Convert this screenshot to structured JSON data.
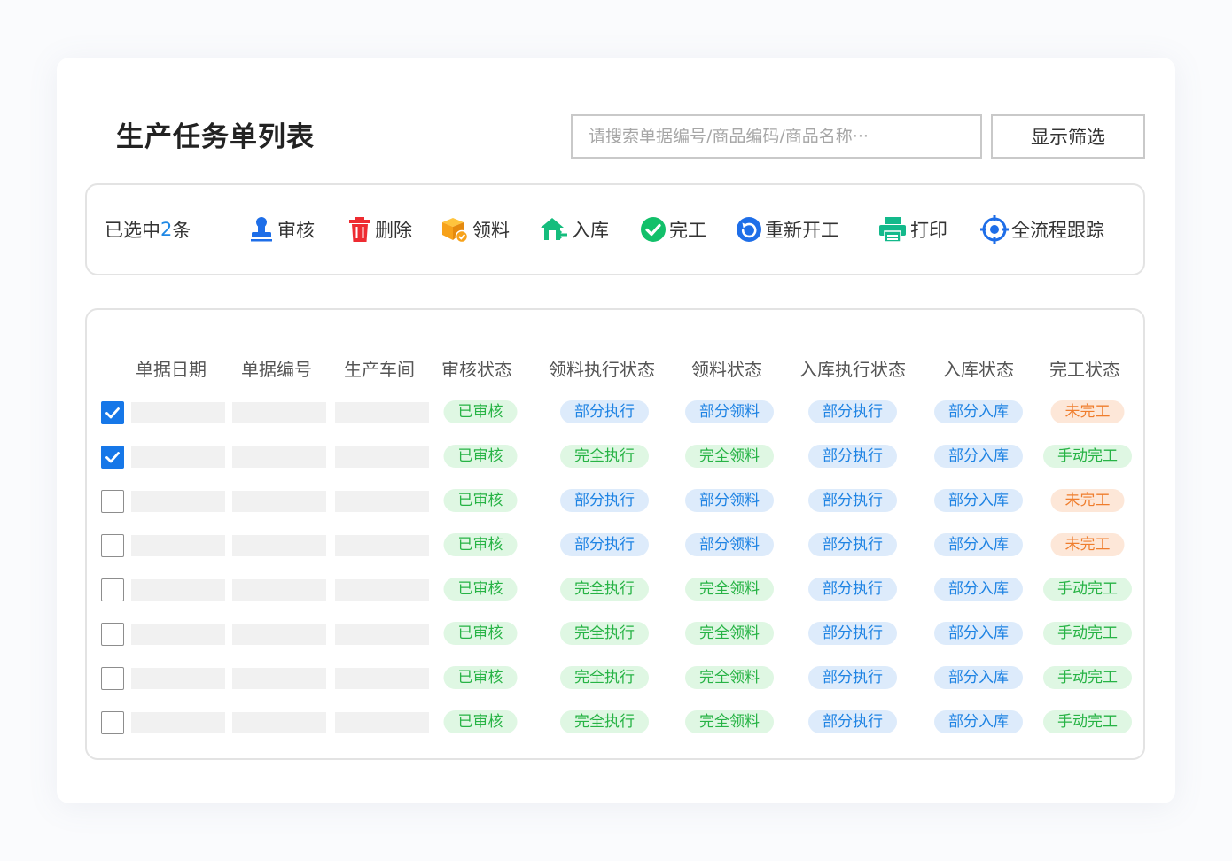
{
  "header": {
    "title": "生产任务单列表",
    "search_placeholder": "请搜索单据编号/商品编码/商品名称···",
    "filter_button": "显示筛选"
  },
  "toolbar": {
    "selected_prefix": "已选中",
    "selected_count": "2",
    "selected_suffix": "条",
    "actions": [
      {
        "label": "审核",
        "icon": "stamp-icon",
        "color": "#1e6ee8"
      },
      {
        "label": "删除",
        "icon": "trash-icon",
        "color": "#ee2b31"
      },
      {
        "label": "领料",
        "icon": "box-icon",
        "color": "#f7a21a"
      },
      {
        "label": "入库",
        "icon": "warehouse-in-icon",
        "color": "#15bd7d"
      },
      {
        "label": "完工",
        "icon": "check-circle-icon",
        "color": "#12c06a"
      },
      {
        "label": "重新开工",
        "icon": "restart-icon",
        "color": "#1e6ee8"
      },
      {
        "label": "打印",
        "icon": "printer-icon",
        "color": "#13b98b"
      },
      {
        "label": "全流程跟踪",
        "icon": "target-icon",
        "color": "#1e6ee8"
      }
    ]
  },
  "table": {
    "columns": [
      "单据日期",
      "单据编号",
      "生产车间",
      "审核状态",
      "领料执行状态",
      "领料状态",
      "入库执行状态",
      "入库状态",
      "完工状态"
    ],
    "rows": [
      {
        "checked": true,
        "statuses": [
          "已审核",
          "部分执行",
          "部分领料",
          "部分执行",
          "部分入库",
          "未完工"
        ],
        "tones": [
          "green",
          "blue",
          "blue",
          "blue",
          "blue",
          "orange"
        ]
      },
      {
        "checked": true,
        "statuses": [
          "已审核",
          "完全执行",
          "完全领料",
          "部分执行",
          "部分入库",
          "手动完工"
        ],
        "tones": [
          "green",
          "green",
          "green",
          "blue",
          "blue",
          "green"
        ]
      },
      {
        "checked": false,
        "statuses": [
          "已审核",
          "部分执行",
          "部分领料",
          "部分执行",
          "部分入库",
          "未完工"
        ],
        "tones": [
          "green",
          "blue",
          "blue",
          "blue",
          "blue",
          "orange"
        ]
      },
      {
        "checked": false,
        "statuses": [
          "已审核",
          "部分执行",
          "部分领料",
          "部分执行",
          "部分入库",
          "未完工"
        ],
        "tones": [
          "green",
          "blue",
          "blue",
          "blue",
          "blue",
          "orange"
        ]
      },
      {
        "checked": false,
        "statuses": [
          "已审核",
          "完全执行",
          "完全领料",
          "部分执行",
          "部分入库",
          "手动完工"
        ],
        "tones": [
          "green",
          "green",
          "green",
          "blue",
          "blue",
          "green"
        ]
      },
      {
        "checked": false,
        "statuses": [
          "已审核",
          "完全执行",
          "完全领料",
          "部分执行",
          "部分入库",
          "手动完工"
        ],
        "tones": [
          "green",
          "green",
          "green",
          "blue",
          "blue",
          "green"
        ]
      },
      {
        "checked": false,
        "statuses": [
          "已审核",
          "完全执行",
          "完全领料",
          "部分执行",
          "部分入库",
          "手动完工"
        ],
        "tones": [
          "green",
          "green",
          "green",
          "blue",
          "blue",
          "green"
        ]
      },
      {
        "checked": false,
        "statuses": [
          "已审核",
          "完全执行",
          "完全领料",
          "部分执行",
          "部分入库",
          "手动完工"
        ],
        "tones": [
          "green",
          "green",
          "green",
          "blue",
          "blue",
          "green"
        ]
      }
    ]
  },
  "colors": {
    "accent": "#1677e8",
    "green_text": "#27b345",
    "green_bg": "#dff7e3",
    "blue_text": "#1e83e3",
    "blue_bg": "#ddebfb",
    "orange_text": "#ef7d2d",
    "orange_bg": "#fde7d8"
  }
}
